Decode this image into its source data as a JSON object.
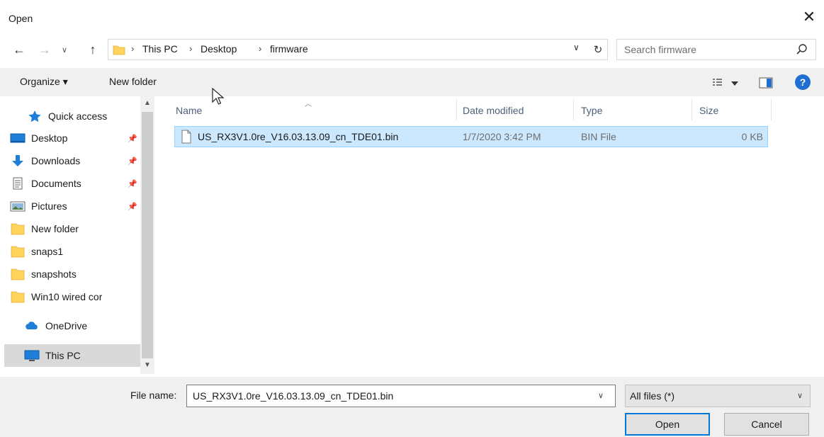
{
  "window": {
    "title": "Open"
  },
  "address": {
    "crumbs": [
      "This PC",
      "Desktop",
      "firmware"
    ]
  },
  "search": {
    "placeholder": "Search firmware"
  },
  "toolbar": {
    "organize_label": "Organize ▾",
    "new_folder_label": "New folder",
    "help_label": "?"
  },
  "nav": {
    "items": [
      {
        "label": "Quick access",
        "icon": "star-icon",
        "pinned": false
      },
      {
        "label": "Desktop",
        "icon": "desktop-icon",
        "pinned": true
      },
      {
        "label": "Downloads",
        "icon": "download-icon",
        "pinned": true
      },
      {
        "label": "Documents",
        "icon": "documents-icon",
        "pinned": true
      },
      {
        "label": "Pictures",
        "icon": "pictures-icon",
        "pinned": true
      },
      {
        "label": "New folder",
        "icon": "folder-icon",
        "pinned": false
      },
      {
        "label": "snaps1",
        "icon": "folder-icon",
        "pinned": false
      },
      {
        "label": "snapshots",
        "icon": "folder-icon",
        "pinned": false
      },
      {
        "label": "Win10 wired cor",
        "icon": "folder-icon",
        "pinned": false
      },
      {
        "label": "OneDrive",
        "icon": "cloud-icon",
        "pinned": false
      },
      {
        "label": "This PC",
        "icon": "computer-icon",
        "pinned": false
      }
    ]
  },
  "columns": {
    "name": "Name",
    "date": "Date modified",
    "type": "Type",
    "size": "Size"
  },
  "files": [
    {
      "name": "US_RX3V1.0re_V16.03.13.09_cn_TDE01.bin",
      "date": "1/7/2020 3:42 PM",
      "type": "BIN File",
      "size": "0 KB",
      "selected": true
    }
  ],
  "bottom": {
    "filename_label": "File name:",
    "filename_value": "US_RX3V1.0re_V16.03.13.09_cn_TDE01.bin",
    "filetype_value": "All files (*)",
    "open_label": "Open",
    "cancel_label": "Cancel"
  },
  "colors": {
    "accent": "#0078d7",
    "selection": "#cce8ff",
    "folder": "#ffd35c",
    "header_text": "#4c607a"
  }
}
